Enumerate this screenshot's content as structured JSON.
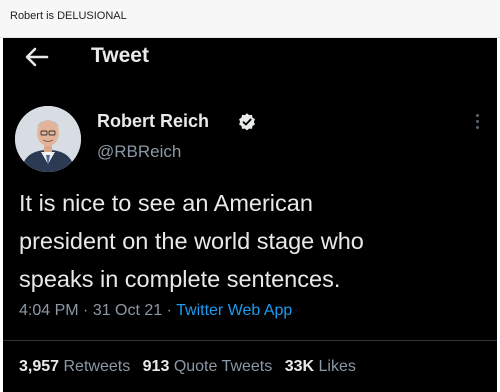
{
  "post": {
    "title": "Robert is DELUSIONAL"
  },
  "header": {
    "back_icon": "arrow-left-icon",
    "title": "Tweet"
  },
  "author": {
    "name": "Robert Reich",
    "handle": "@RBReich",
    "verified_icon": "verified-badge-icon",
    "menu_icon": "more-vertical-icon"
  },
  "tweet": {
    "lines": [
      "It is nice to see an American",
      "president on the world stage who",
      "speaks in complete sentences."
    ],
    "time": "4:04 PM",
    "sep1": " · ",
    "date": "31 Oct 21",
    "sep2": " · ",
    "source": "Twitter Web App"
  },
  "stats": {
    "retweets_count": "3,957",
    "retweets_label": "Retweets",
    "quotes_count": "913",
    "quotes_label": "Quote Tweets",
    "likes_count": "33K",
    "likes_label": "Likes"
  },
  "colors": {
    "background": "#000000",
    "text": "#e7e9ea",
    "secondary": "#8b98a5",
    "link": "#1d9bf0"
  }
}
